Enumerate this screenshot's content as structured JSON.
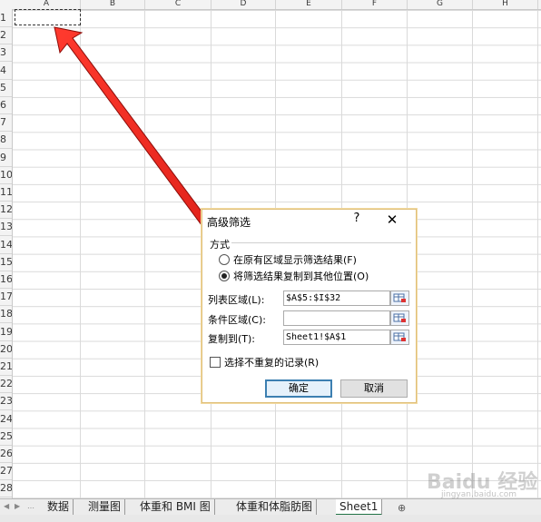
{
  "sheet": {
    "columns": [
      "A",
      "B",
      "C",
      "D",
      "E",
      "F",
      "G",
      "H"
    ],
    "rows": [
      "1",
      "2",
      "3",
      "4",
      "5",
      "6",
      "7",
      "8",
      "9",
      "10",
      "11",
      "12",
      "13",
      "14",
      "15",
      "16",
      "17",
      "18",
      "19",
      "20",
      "21",
      "22",
      "23",
      "24",
      "25",
      "26",
      "27",
      "28"
    ]
  },
  "dialog": {
    "title": "高级筛选",
    "help": "?",
    "close": "✕",
    "group_title": "方式",
    "option1": "在原有区域显示筛选结果(F)",
    "option2": "将筛选结果复制到其他位置(O)",
    "list_range_label": "列表区域(L):",
    "list_range_value": "$A$5:$I$32",
    "criteria_label": "条件区域(C):",
    "criteria_value": "",
    "copy_to_label": "复制到(T):",
    "copy_to_value": "Sheet1!$A$1",
    "unique_label": "选择不重复的记录(R)",
    "ok_label": "确定",
    "cancel_label": "取消"
  },
  "tabs": [
    "数据",
    "测量图",
    "体重和 BMI 图",
    "体重和体脂肪图",
    "Sheet1"
  ],
  "colors": {
    "arrow": "#e8201c",
    "accent": "#217346"
  },
  "watermark": {
    "text": "Baidu 经验",
    "url": "jingyan.baidu.com"
  }
}
